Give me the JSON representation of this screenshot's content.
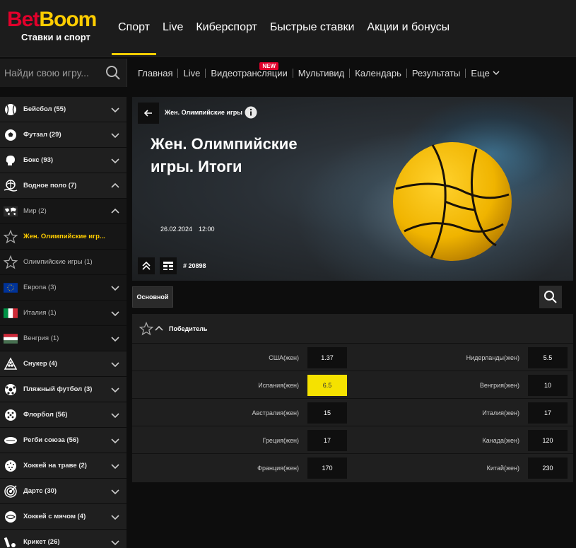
{
  "brand": {
    "word_a": "Bet",
    "word_b": "Boom",
    "tagline": "Ставки и спорт"
  },
  "colors": {
    "accent": "#ffcd00",
    "brand_red": "#e1002b",
    "selected_odd": "#f5e200",
    "panel": "#1f1f1f",
    "bg": "#0d0d0d"
  },
  "main_nav": [
    {
      "label": "Спорт",
      "active": true
    },
    {
      "label": "Live"
    },
    {
      "label": "Киберспорт"
    },
    {
      "label": "Быстрые ставки"
    },
    {
      "label": "Акции и бонусы"
    }
  ],
  "search": {
    "placeholder": "Найди свою игру...",
    "icon": "search-icon"
  },
  "sub_nav": {
    "items": [
      "Главная",
      "Live",
      "Видеотрансляции",
      "Мультивид",
      "Календарь",
      "Результаты"
    ],
    "new_badge": "NEW",
    "more": "Еще"
  },
  "sidebar": [
    {
      "label": "Бейсбол (55)",
      "icon": "baseball-icon",
      "chevron": "down"
    },
    {
      "label": "Футзал (29)",
      "icon": "futsal-ball-icon",
      "chevron": "down"
    },
    {
      "label": "Бокс (93)",
      "icon": "boxing-glove-icon",
      "chevron": "down"
    },
    {
      "label": "Водное поло (7)",
      "icon": "water-polo-icon",
      "chevron": "up"
    },
    {
      "label": "Мир (2)",
      "icon": "world-map-icon",
      "chevron": "up",
      "sub": true
    },
    {
      "label": "Жен. Олимпийские игр...",
      "icon": "star-icon",
      "sub": true,
      "active": true
    },
    {
      "label": "Олимпийские игры (1)",
      "icon": "star-icon",
      "sub": true
    },
    {
      "label": "Европа (3)",
      "icon": "eu-flag-icon",
      "chevron": "down",
      "sub": true
    },
    {
      "label": "Италия (1)",
      "icon": "italy-flag-icon",
      "chevron": "down",
      "sub": true
    },
    {
      "label": "Венгрия (1)",
      "icon": "hungary-flag-icon",
      "chevron": "down",
      "sub": true
    },
    {
      "label": "Снукер (4)",
      "icon": "snooker-icon",
      "chevron": "down"
    },
    {
      "label": "Пляжный футбол (3)",
      "icon": "beach-soccer-icon",
      "chevron": "down"
    },
    {
      "label": "Флорбол (56)",
      "icon": "floorball-icon",
      "chevron": "down"
    },
    {
      "label": "Регби союза (56)",
      "icon": "rugby-ball-icon",
      "chevron": "down"
    },
    {
      "label": "Хоккей на траве (2)",
      "icon": "field-hockey-icon",
      "chevron": "down"
    },
    {
      "label": "Дартс (30)",
      "icon": "darts-target-icon",
      "chevron": "down"
    },
    {
      "label": "Хоккей с мячом (4)",
      "icon": "bandy-icon",
      "chevron": "down"
    },
    {
      "label": "Крикет (26)",
      "icon": "cricket-icon",
      "chevron": "down"
    }
  ],
  "event": {
    "breadcrumb": "Жен. Олимпийские игры",
    "title": "Жен. Олимпийские игры. Итоги",
    "date": "26.02.2024",
    "time": "12:00",
    "id": "# 20898"
  },
  "tabs": {
    "main": "Основной"
  },
  "market": {
    "title": "Победитель",
    "rows": [
      {
        "left": "США(жен)",
        "left_odd": "1.37",
        "right": "Нидерланды(жен)",
        "right_odd": "5.5"
      },
      {
        "left": "Испания(жен)",
        "left_odd": "6.5",
        "left_selected": true,
        "right": "Венгрия(жен)",
        "right_odd": "10"
      },
      {
        "left": "Австралия(жен)",
        "left_odd": "15",
        "right": "Италия(жен)",
        "right_odd": "17"
      },
      {
        "left": "Греция(жен)",
        "left_odd": "17",
        "right": "Канада(жен)",
        "right_odd": "120"
      },
      {
        "left": "Франция(жен)",
        "left_odd": "170",
        "right": "Китай(жен)",
        "right_odd": "230"
      }
    ]
  }
}
